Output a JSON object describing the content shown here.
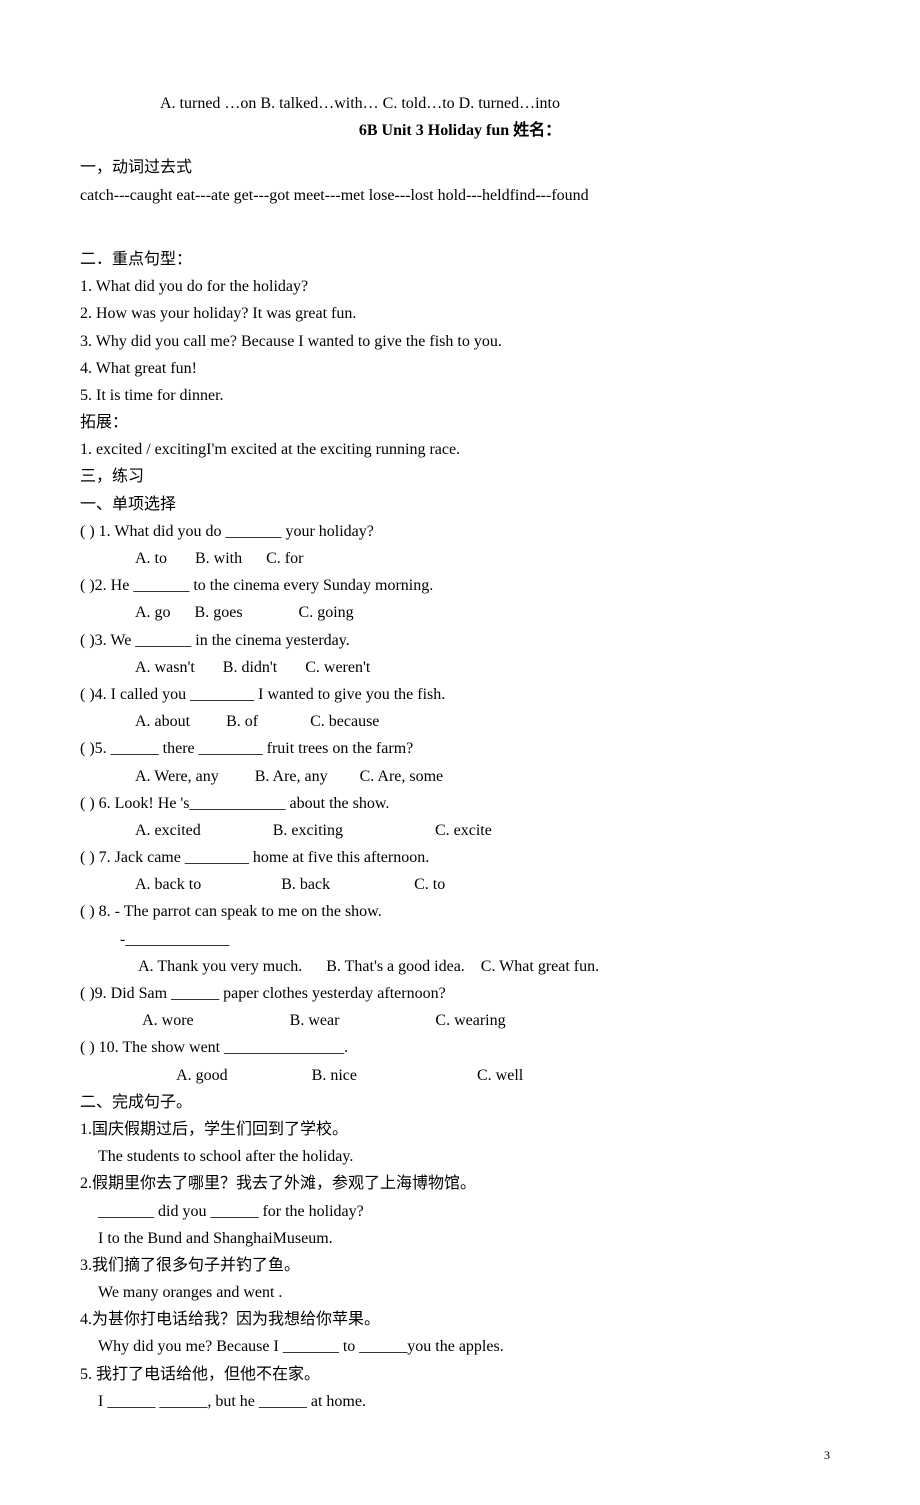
{
  "topOptions": "A. turned …on      B. talked…with…      C. told…to   D. turned…into",
  "title": "6B Unit 3 Holiday fun      姓名：",
  "sec1_label": "一，动词过去式",
  "sec1_line": "catch---caught eat---ate      get---got      meet---met      lose---lost      hold---heldfind---found",
  "sec2_label": "二．重点句型：",
  "sec2_lines": [
    "1. What did you do for the holiday?",
    "2. How was your holiday? It was great fun.",
    "3. Why did you call me? Because I wanted to give the fish to you.",
    "4. What great fun!",
    "5. It is time for dinner."
  ],
  "extend_label": "拓展：",
  "extend_line": "1. excited / excitingI'm excited at the exciting running race.",
  "sec3_label": "三，练习",
  "sec3a_label": "一、单项选择",
  "mc": [
    {
      "q": "(       ) 1. What did you do _______ your holiday?",
      "opts": "A. to       B. with      C. for"
    },
    {
      "q": "(      )2. He _______    to the cinema every Sunday morning.",
      "opts": "A. go      B. goes              C. going"
    },
    {
      "q": "(      )3. We _______ in the cinema yesterday.",
      "opts": "A. wasn't       B. didn't       C. weren't"
    },
    {
      "q": "(      )4. I called you ________ I wanted to give you the fish.",
      "opts": "A. about         B. of             C. because"
    },
    {
      "q": "(      )5. ______ there ________ fruit trees on the farm?",
      "opts": "A. Were, any         B. Are, any        C. Are, some"
    },
    {
      "q": "(       ) 6. Look! He 's____________ about the show.",
      "opts": "A. excited                  B. exciting                       C. excite"
    },
    {
      "q": "(       ) 7. Jack came ________ home at five this afternoon.",
      "opts": "A. back to                    B. back                     C. to"
    },
    {
      "q": "(       ) 8. - The parrot can speak to me on the show.",
      "dash": "          -_____________",
      "opts": " A. Thank you very much.      B. That's a good idea.    C. What great fun."
    },
    {
      "q": "(      )9. Did Sam ______ paper clothes yesterday afternoon?",
      "opts": "  A. wore                        B. wear                        C. wearing"
    },
    {
      "q": "(       ) 10. The show went _______________.",
      "opts": "   A. good                     B. nice                              C. well"
    }
  ],
  "sec3b_label": "二、完成句子。",
  "comp": [
    {
      "zh": "1.国庆假期过后，学生们回到了学校。",
      "en": "The students   to school after the    holiday."
    },
    {
      "zh": "2.假期里你去了哪里？我去了外滩，参观了上海博物馆。",
      "en1": "_______ did you ______ for the holiday?",
      "en2": "I    to the Bund and ShanghaiMuseum."
    },
    {
      "zh": "3.我们摘了很多句子并钓了鱼。",
      "en": "We   many oranges and went ."
    },
    {
      "zh": "4.为甚你打电话给我？因为我想给你苹果。",
      "en": "Why did you    me? Because I _______ to ______you the apples."
    },
    {
      "zh": "5. 我打了电话给他，但他不在家。",
      "en": "I ______ ______, but he ______ at home."
    }
  ],
  "pageNum": "3"
}
